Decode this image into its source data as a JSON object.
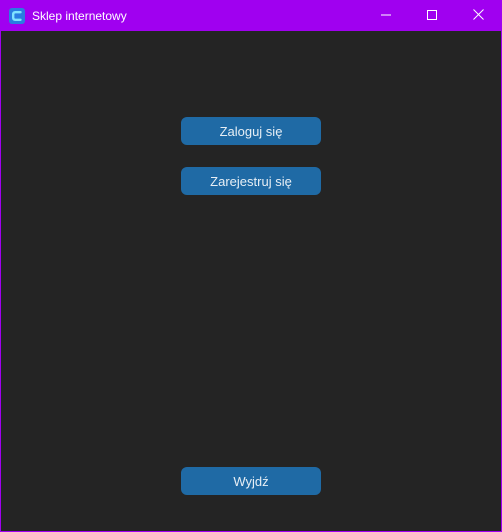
{
  "window": {
    "title": "Sklep internetowy",
    "app_icon": "app-logo-icon",
    "controls": {
      "minimize_icon": "minimize-icon",
      "maximize_icon": "maximize-icon",
      "close_icon": "close-icon"
    }
  },
  "main": {
    "login_label": "Zaloguj się",
    "register_label": "Zarejestruj się",
    "exit_label": "Wyjdź"
  },
  "colors": {
    "titlebar": "#a000f0",
    "background": "#242424",
    "button": "#1f6aa5",
    "button_text": "#e6eef5"
  }
}
